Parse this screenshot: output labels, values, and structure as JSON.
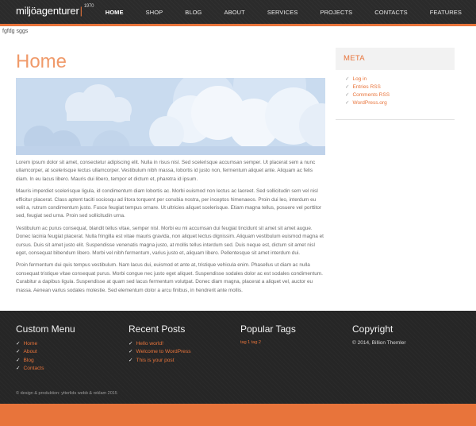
{
  "header": {
    "logo_text": "miljöagenturer",
    "logo_sup": "1970",
    "nav": [
      {
        "label": "HOME",
        "active": true
      },
      {
        "label": "SHOP"
      },
      {
        "label": "BLOG"
      },
      {
        "label": "ABOUT"
      },
      {
        "label": "SERVICES"
      },
      {
        "label": "PROJECTS"
      },
      {
        "label": "CONTACTS"
      },
      {
        "label": "FEATURES"
      }
    ]
  },
  "subtitle": "fgfdg sggs",
  "main": {
    "title": "Home",
    "paragraphs": [
      "Lorem ipsum dolor sit amet, consectetur adipiscing elit. Nulla in risus nisl. Sed scelerisque accumsan semper. Ut placerat sem a nunc ullamcorper, at scelerisque lectus ullamcorper. Vestibulum nibh massa, lobortis id justo non, fermentum aliquet ante. Aliquam ac felis diam. In eu lacus libero. Mauris dui libero, tempor et dictum et, pharetra id ipsum.",
      "Mauris imperdiet scelerisque ligula, id condimentum diam lobortis ac. Morbi euismod non lectus ac laoreet. Sed sollicitudin sem vel nisl efficitur placerat. Class aptent taciti sociosqu ad litora torquent per conubia nostra, per inceptos himenaeos. Proin dui leo, interdum eu velit a, rutrum condimentum justo. Fusce feugiat tempus ornare. Ut ultricies aliquet scelerisque. Etiam magna tellus, posuere vel porttitor sed, feugiat sed urna. Proin sed sollicitudin urna.",
      "Vestibulum ac purus consequat, blandit tellus vitae, semper nisl. Morbi eu mi accumsan dui feugiat tincidunt sit amet sit amet augue. Donec lacinia feugiat placerat. Nulla fringilla est vitae mauris gravida, non aliquet lectus dignissim. Aliquam vestibulum euismod magna et cursus. Duis sit amet justo elit. Suspendisse venenatis magna justo, at mollis tellus interdum sed. Duis neque est, dictum sit amet nisl eget, consequat bibendum libero. Morbi vel nibh fermentum, varius justo et, aliquam libero. Pellentesque sit amet interdum dui.",
      "Proin fermentum dui quis tempus vestibulum. Nam lacus dui, euismod et ante at, tristique vehicula enim. Phasellus ut diam ac nulla consequat tristique vitae consequat purus. Morbi congue nec justo eget aliquet. Suspendisse sodales dolor ac est sodales condimentum. Curabitur a dapibus ligula. Suspendisse at quam sed lacus fermentum volutpat. Donec diam magna, placerat a aliquet vel, auctor eu massa. Aenean varius sodales molestie. Sed elementum dolor a arcu finibus, in hendrerit ante mollis."
    ]
  },
  "sidebar": {
    "meta_title": "META",
    "links": [
      "Log in",
      "Entries RSS",
      "Comments RSS",
      "WordPress.org"
    ]
  },
  "footer": {
    "custom_menu_title": "Custom Menu",
    "custom_menu": [
      "Home",
      "About",
      "Blog",
      "Contacts"
    ],
    "recent_posts_title": "Recent Posts",
    "recent_posts": [
      "Hello world!",
      "Welcome to WordPress",
      "This is your post"
    ],
    "popular_tags_title": "Popular Tags",
    "tags": "tag 1 tag 2",
    "copyright_title": "Copyright",
    "copyright_text": "© 2014, Billion Themler",
    "credit": "© design & produktion: ytterlids webb & reklam 2015"
  },
  "colors": {
    "accent": "#e8743b",
    "header_bg": "#2b2b2b",
    "footer_bg": "#262626",
    "sky": "#c9dbef"
  }
}
